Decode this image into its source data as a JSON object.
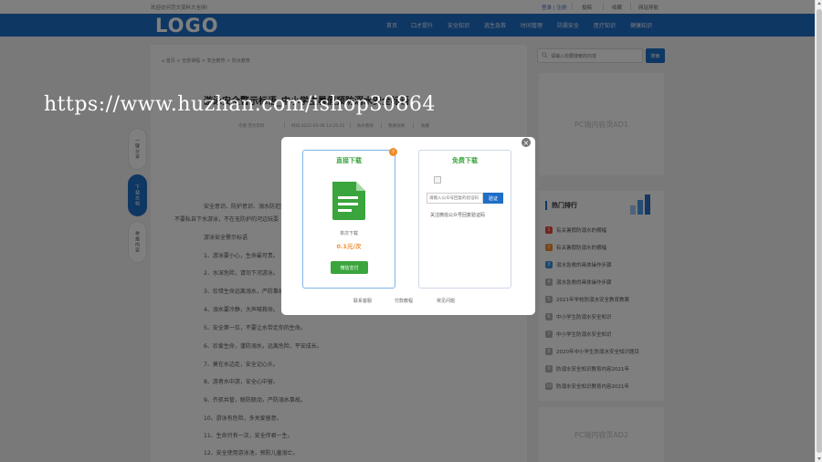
{
  "topbar": {
    "welcome": "欢迎访问范文资料大全网!",
    "login": "登录 | 注册",
    "links": [
      "投稿",
      "收藏",
      "网站导航"
    ]
  },
  "nav": {
    "logo": "LOGO",
    "items": [
      "首页",
      "口才提升",
      "安全知识",
      "逃生急救",
      "时间管理",
      "防震安全",
      "医疗知识",
      "健康知识"
    ]
  },
  "float_bar": {
    "items": [
      "一键分享",
      "下载文档",
      "举报内容"
    ]
  },
  "article": {
    "breadcrumb": "首页 > 全部课程 > 安全教育 > 防水教育",
    "title": "游泳安全警示标语_中小学生暑假预防溺水安全标语",
    "meta": [
      "作者:范文资料",
      "时间:2022-05-08 13:25:31",
      "防水教育",
      "我要投稿",
      "收藏"
    ],
    "lines": [
      "安全意识、防护意识、溺水防范知识宣传",
      "不要私自下水游泳，不在无防护的河边玩耍",
      "游泳安全警示标语",
      "1、游泳要小心，生命最可贵。",
      "2、水深危险，请勿下河游泳。",
      "3、珍惜生命远离溺水，严防事故平安成长。",
      "4、溺水要冷静，大声喊救命。",
      "5、安全第一位，不要让水带走你的生命。",
      "6、珍爱生命，谨防溺水，远离危险，平安成长。",
      "7、莫在水边走，安全记心头。",
      "8、游者水中游，安全心中留。",
      "9、齐抓共管，联防联动，严防溺水事故。",
      "10、游泳有危险，多关爱留意。",
      "11、生命只有一次，安全伴君一生。",
      "12、安全使用游泳池，预防儿童溺亡。"
    ]
  },
  "search": {
    "placeholder": "请输入你要搜索的内容",
    "button": "搜索"
  },
  "ads": {
    "label": "PC端内容页AD1",
    "label2": "PC端内容页AD2"
  },
  "hot": {
    "title": "热门排行",
    "items": [
      "有关暑假防溺水的横幅",
      "有关暑假防溺水的横幅",
      "溺水急救的具体操作步骤",
      "溺水急救的具体操作步骤",
      "2021年学校防溺水安全教育教案",
      "中小学生防溺水安全知识",
      "中小学生防溺水安全知识",
      "2020年中小学生防溺水安全知识题目",
      "防溺水安全知识教育内容2021年",
      "防溺水安全知识教育内容2021年"
    ]
  },
  "modal": {
    "direct_title": "直接下载",
    "free_title": "免费下载",
    "single_label": "单次下载",
    "price": "0.1元/次",
    "pay_button": "微信支付",
    "code_placeholder": "请输入公众号回复的验证码",
    "code_button": "验证",
    "code_hint": "关注微信公众号回复验证码",
    "footer": [
      "联系客服",
      "付款教程",
      "常见问题"
    ]
  },
  "watermark": "https://www.huzhan.com/ishop30864",
  "colors": {
    "brand": "#1f6ec7",
    "green": "#3aa53d",
    "orange": "#f08c2c",
    "hot1": "#e64a3b",
    "hot2": "#f08c2c",
    "hot3": "#3e8fd8",
    "rest": "#b3b3b3"
  }
}
